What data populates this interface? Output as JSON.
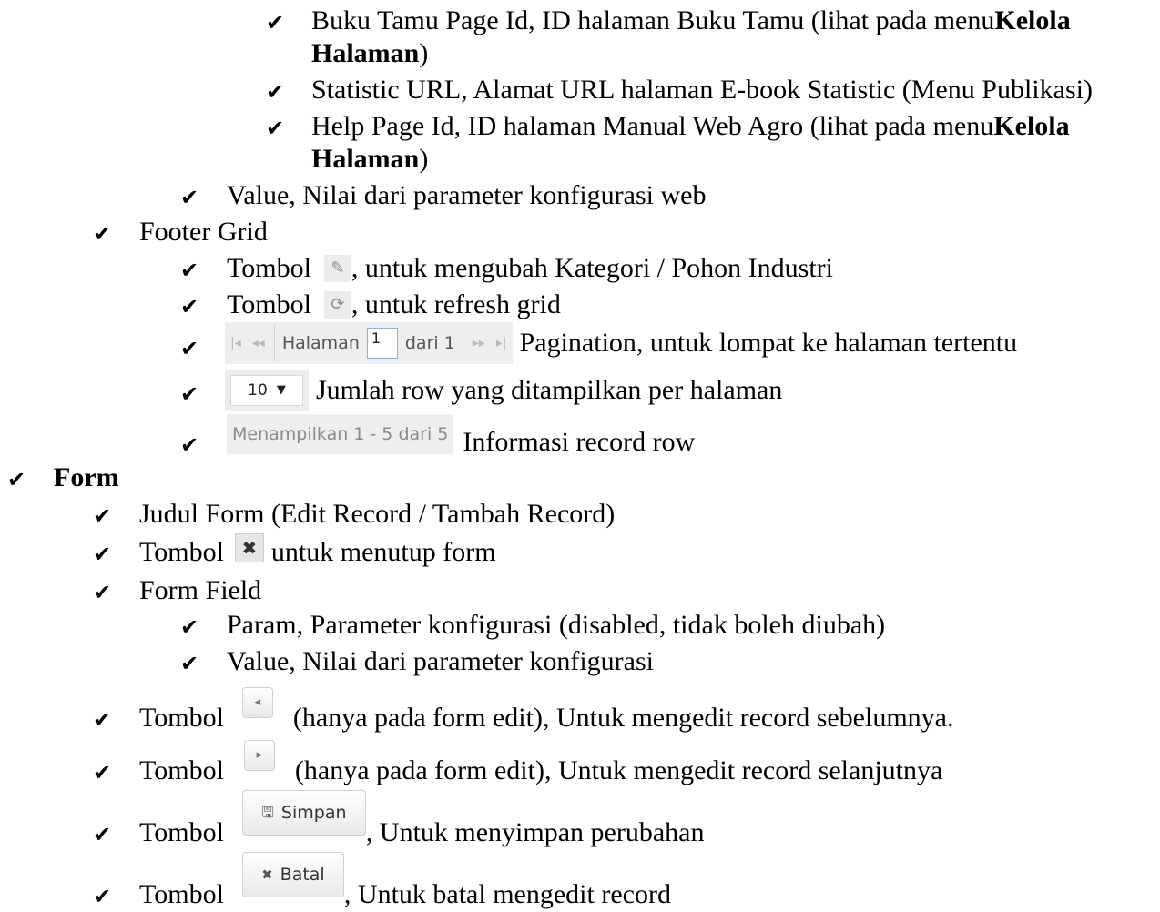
{
  "check_glyph": "✔",
  "lines": {
    "buku_tamu_a": "Buku Tamu Page Id, ID halaman Buku Tamu (lihat pada menu ",
    "kelola_1": "Kelola",
    "halaman_1": "Halaman",
    "close_paren_1": ")",
    "statistic": "Statistic URL, Alamat URL halaman E-book Statistic (Menu Publikasi)",
    "help_a": "Help Page Id, ID halaman Manual Web Agro (lihat pada menu ",
    "kelola_2": "Kelola",
    "halaman_2": "Halaman",
    "close_paren_2": ")",
    "value_web": "Value, Nilai dari parameter konfigurasi web",
    "footer_grid": "Footer Grid",
    "tombol_edit_pre": "Tombol",
    "tombol_edit_post": ", untuk mengubah Kategori / Pohon Industri",
    "tombol_refresh_pre": "Tombol",
    "tombol_refresh_post": ", untuk refresh grid",
    "pagination_desc": "Pagination, untuk lompat ke halaman tertentu",
    "rows_desc": "Jumlah row yang ditampilkan per halaman",
    "record_info_desc": "Informasi record row",
    "form": "Form",
    "judul_form": "Judul Form (Edit Record / Tambah Record)",
    "tombol_close_pre": "Tombol",
    "tombol_close_post": "untuk menutup form",
    "form_field": "Form Field",
    "param": "Param, Parameter konfigurasi (disabled, tidak boleh diubah)",
    "value": "Value, Nilai dari parameter konfigurasi",
    "tombol_prev_pre": "Tombol",
    "tombol_prev_post": "(hanya pada form edit), Untuk mengedit record sebelumnya.",
    "tombol_next_pre": "Tombol",
    "tombol_next_post": "(hanya pada form edit), Untuk mengedit record selanjutnya",
    "tombol_save_pre": "Tombol",
    "tombol_save_post": ", Untuk menyimpan perubahan",
    "tombol_cancel_pre": "Tombol",
    "tombol_cancel_post": ", Untuk batal mengedit record"
  },
  "pager": {
    "first": "|◂",
    "prev": "◂◂",
    "page_label": "Halaman",
    "page_value": "1",
    "of_label": "dari 1",
    "next": "▸▸",
    "last": "▸|"
  },
  "rows_select": {
    "value": "10",
    "arrow": "▼"
  },
  "record_info": "Menampilkan 1 - 5 dari 5",
  "buttons": {
    "edit_icon": "✎",
    "refresh_icon": "⟳",
    "close_icon": "✖",
    "prev_icon": "◂",
    "next_icon": "▸",
    "save_icon": "🖫",
    "save_label": "Simpan",
    "cancel_icon": "✖",
    "cancel_label": "Batal"
  }
}
